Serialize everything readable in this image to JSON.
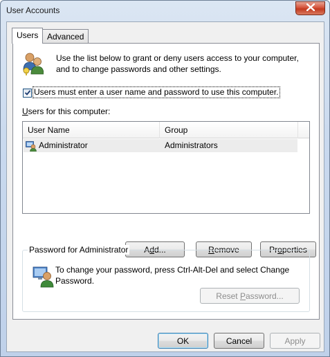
{
  "window": {
    "title": "User Accounts",
    "close_label": "×"
  },
  "tabs": [
    {
      "label": "Users",
      "selected": true
    },
    {
      "label": "Advanced",
      "selected": false
    }
  ],
  "intro": {
    "text": "Use the list below to grant or deny users access to your computer, and to change passwords and other settings.",
    "icon": "users-icon"
  },
  "require_login": {
    "label": "Users must enter a user name and password to use this computer.",
    "checked": true
  },
  "users_list": {
    "label": "Users for this computer:",
    "columns": [
      "User Name",
      "Group"
    ],
    "rows": [
      {
        "name": "Administrator",
        "group": "Administrators",
        "icon": "admin-user-icon",
        "selected": true
      }
    ]
  },
  "list_buttons": {
    "add": {
      "pre": "A",
      "u": "d",
      "post": "d..."
    },
    "remove": {
      "pre": "",
      "u": "R",
      "post": "emove"
    },
    "properties": {
      "pre": "Pr",
      "u": "o",
      "post": "perties"
    }
  },
  "password_box": {
    "caption": "Password for Administrator",
    "text": "To change your password, press Ctrl-Alt-Del and select Change Password.",
    "icon": "user-password-icon",
    "reset": {
      "pre": "Reset ",
      "u": "P",
      "post": "assword...",
      "enabled": false
    }
  },
  "dialog_buttons": {
    "ok": "OK",
    "cancel": "Cancel",
    "apply": "Apply"
  }
}
